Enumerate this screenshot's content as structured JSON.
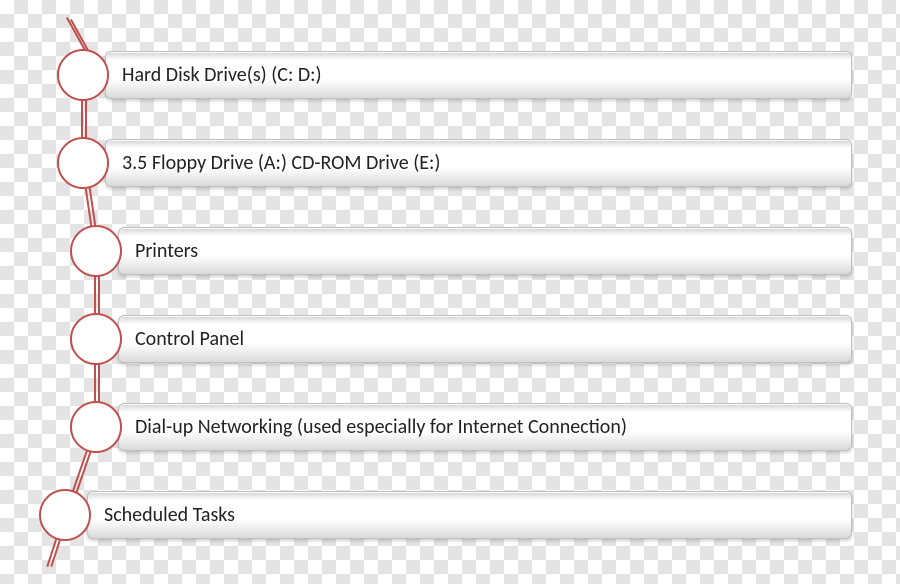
{
  "items": [
    {
      "label": "Hard Disk Drive(s) (C: D:)"
    },
    {
      "label": "3.5 Floppy Drive (A:) CD-ROM Drive (E:)"
    },
    {
      "label": "Printers"
    },
    {
      "label": "Control Panel"
    },
    {
      "label": "Dial-up Networking (used especially for Internet Connection)"
    },
    {
      "label": "Scheduled Tasks"
    }
  ]
}
